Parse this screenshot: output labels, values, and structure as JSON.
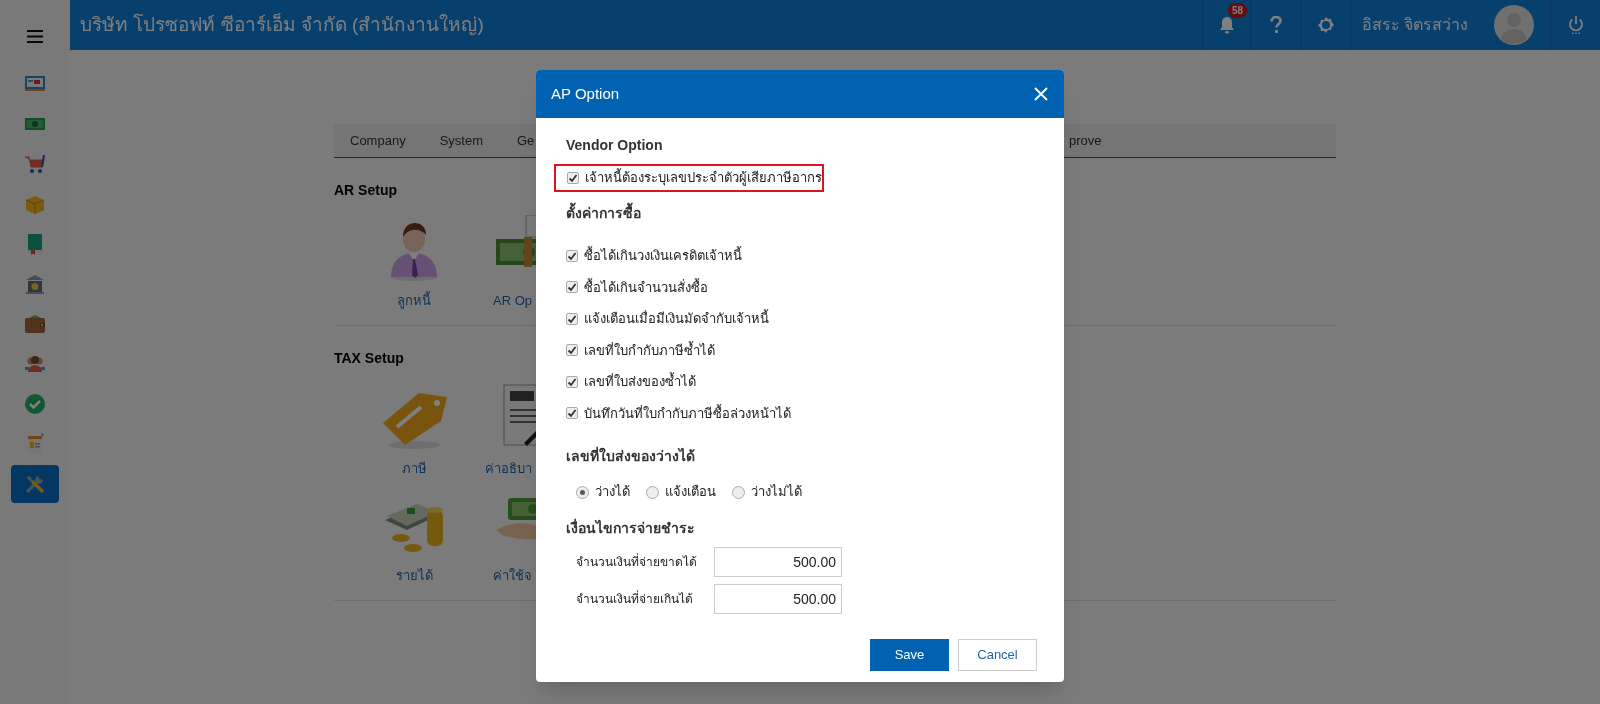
{
  "topbar": {
    "company": "บริษัท โปรซอฟท์ ซีอาร์เอ็ม จำกัด (สำนักงานใหญ่)",
    "notifications": {
      "count": "58"
    },
    "user": {
      "name": "อิสระ จิตรสว่าง"
    }
  },
  "sidebar": {
    "items": [
      {
        "kind": "monitor",
        "selected": false
      },
      {
        "kind": "cash",
        "selected": false
      },
      {
        "kind": "cart",
        "selected": false
      },
      {
        "kind": "box",
        "selected": false
      },
      {
        "kind": "book",
        "selected": false
      },
      {
        "kind": "bank",
        "selected": false
      },
      {
        "kind": "wallet",
        "selected": false
      },
      {
        "kind": "people",
        "selected": false
      },
      {
        "kind": "check",
        "selected": false
      },
      {
        "kind": "invoice",
        "selected": false
      },
      {
        "kind": "tools",
        "selected": true
      }
    ]
  },
  "tabs": [
    {
      "label": "Company"
    },
    {
      "label": "System"
    },
    {
      "label": "Ge"
    },
    {
      "label": "prove"
    }
  ],
  "sections": [
    {
      "title": "AR Setup",
      "items": [
        {
          "label": "ลูกหนี้",
          "kind": "person"
        },
        {
          "label": "AR Op",
          "kind": "money"
        }
      ]
    },
    {
      "title": "TAX Setup",
      "items": [
        {
          "label": "ภาษี",
          "kind": "vat"
        },
        {
          "label": "ค่าอธิบา",
          "kind": "taxdoc"
        },
        {
          "label": "รายได้",
          "kind": "coins"
        },
        {
          "label": "ค่าใช้จ",
          "kind": "hand"
        }
      ]
    }
  ],
  "dialog": {
    "title": "AP Option",
    "vendor_option": {
      "title": "Vendor Option",
      "options": [
        {
          "label": "เจ้าหนี้ต้องระบุเลขประจำตัวผู้เสียภาษีอากร",
          "checked": true,
          "highlighted": true
        }
      ]
    },
    "purchase_settings": {
      "title": "ตั้งค่าการซื้อ",
      "options": [
        {
          "label": "ซื้อได้เกินวงเงินเครดิตเจ้าหนี้",
          "checked": true,
          "highlighted": false
        },
        {
          "label": "ซื้อได้เกินจำนวนสั่งซื้อ",
          "checked": true,
          "highlighted": false
        },
        {
          "label": "แจ้งเตือนเมื่อมีเงินมัดจำกับเจ้าหนี้",
          "checked": true,
          "highlighted": false
        },
        {
          "label": "เลขที่ใบกำกับภาษีซ้ำได้",
          "checked": true,
          "highlighted": false
        },
        {
          "label": "เลขที่ใบส่งของซ้ำได้",
          "checked": true,
          "highlighted": false
        },
        {
          "label": "บันทึกวันที่ใบกำกับภาษีซื้อล่วงหน้าได้",
          "checked": true,
          "highlighted": false
        }
      ]
    },
    "blank_delivery_no": {
      "title": "เลขที่ใบส่งของว่างได้",
      "options": [
        {
          "label": "ว่างได้",
          "selected": true
        },
        {
          "label": "แจ้งเตือน",
          "selected": false
        },
        {
          "label": "ว่างไม่ได้",
          "selected": false
        }
      ]
    },
    "payment_terms": {
      "title": "เงื่อนไขการจ่ายชำระ",
      "fields": [
        {
          "label": "จำนวนเงินที่จ่ายขาดได้",
          "value": "500.00"
        },
        {
          "label": "จำนวนเงินที่จ่ายเกินได้",
          "value": "500.00"
        }
      ]
    },
    "buttons": [
      {
        "label": "Save",
        "kind": "primary"
      },
      {
        "label": "Cancel",
        "kind": "secondary"
      }
    ]
  }
}
